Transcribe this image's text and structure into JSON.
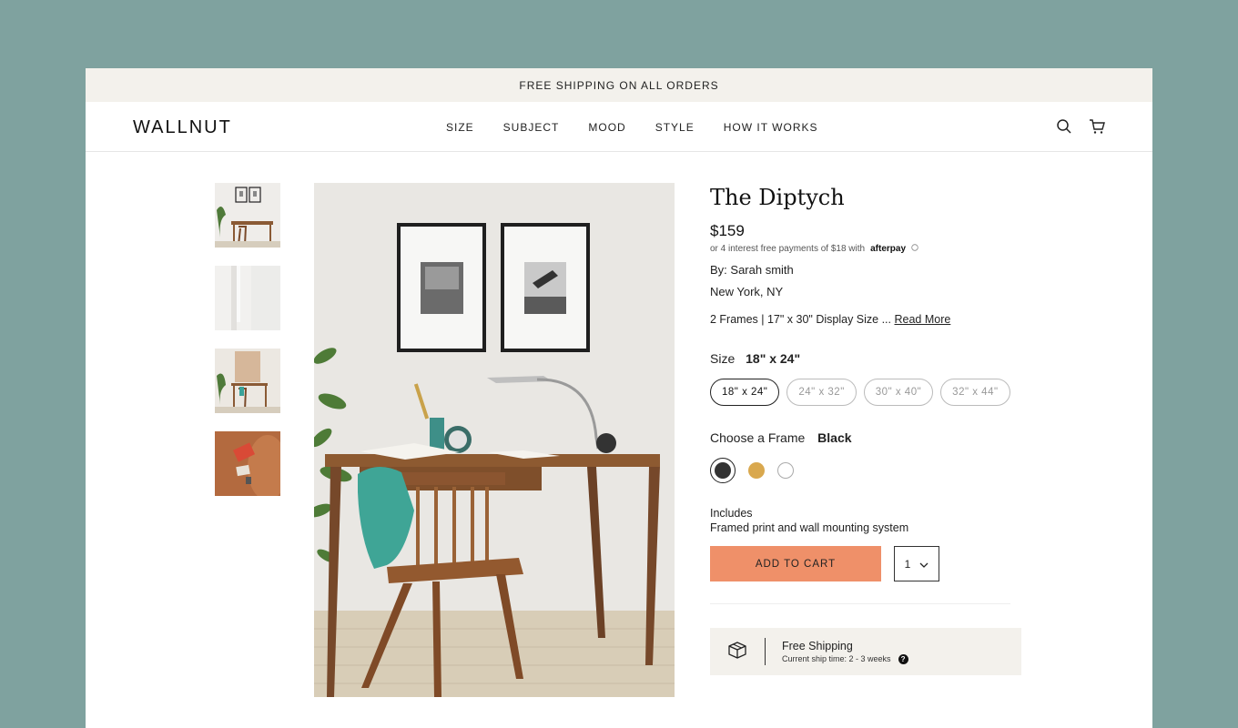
{
  "promo": {
    "text": "FREE SHIPPING ON ALL ORDERS"
  },
  "header": {
    "logo": "WALLNUT",
    "nav": [
      "SIZE",
      "SUBJECT",
      "MOOD",
      "STYLE",
      "HOW IT WORKS"
    ],
    "icons": [
      "search-icon",
      "cart-icon"
    ]
  },
  "gallery": {
    "thumbnails": [
      "thumbnail-desk-room",
      "thumbnail-frame-side",
      "thumbnail-desk-wide",
      "thumbnail-detail-closeup"
    ],
    "main_image": "desk-with-diptych-frames"
  },
  "product": {
    "title": "The Diptych",
    "price": "$159",
    "afterpay_text": "or 4 interest free payments of $18 with",
    "afterpay_brand": "afterpay",
    "artist": "By: Sarah smith",
    "location": "New York, NY",
    "detail": "2 Frames | 17\" x 30\" Display Size ...",
    "read_more": "Read More"
  },
  "size": {
    "label": "Size",
    "selected": "18\" x 24\"",
    "options": [
      "18\" x 24\"",
      "24\" x 32\"",
      "30\" x 40\"",
      "32\" x 44\""
    ]
  },
  "frame": {
    "label": "Choose a Frame",
    "selected": "Black",
    "colors": [
      "#333333",
      "#d9a84e",
      "#ffffff"
    ]
  },
  "includes": {
    "heading": "Includes",
    "value": "Framed print and wall mounting system"
  },
  "cart": {
    "button_label": "ADD TO CART",
    "quantity": "1"
  },
  "shipping": {
    "title": "Free Shipping",
    "subtitle": "Current ship time: 2 - 3 weeks"
  },
  "colors": {
    "page_bg": "#7fa29f",
    "promo_bg": "#f3f1ec",
    "cart_button": "#ef9069"
  }
}
